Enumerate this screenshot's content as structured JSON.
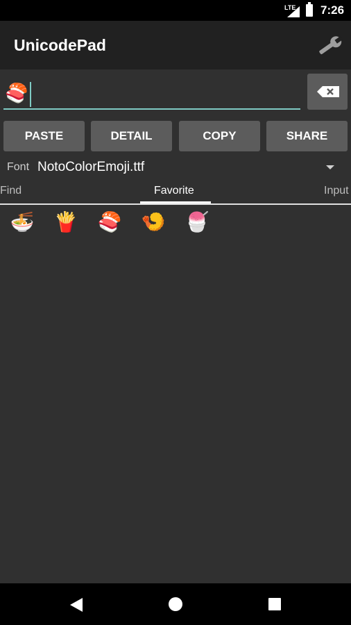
{
  "status_bar": {
    "network": "LTE",
    "time": "7:26"
  },
  "app_bar": {
    "title": "UnicodePad",
    "settings_icon": "wrench-icon"
  },
  "input": {
    "value": "🍣"
  },
  "buttons": {
    "paste": "PASTE",
    "detail": "DETAIL",
    "copy": "COPY",
    "share": "SHARE"
  },
  "font": {
    "label": "Font",
    "value": "NotoColorEmoji.ttf"
  },
  "tabs": [
    {
      "label": "Find",
      "active": false
    },
    {
      "label": "Favorite",
      "active": true
    },
    {
      "label": "Input",
      "active": false
    }
  ],
  "favorites": [
    "🍜",
    "🍟",
    "🍣",
    "🍤",
    "🍧"
  ],
  "nav_bar": {
    "back": "back-icon",
    "home": "home-icon",
    "recent": "recent-apps-icon"
  },
  "colors": {
    "accent": "#7fcbc4",
    "background": "#303030",
    "app_bar": "#212121",
    "button": "#5c5c5c"
  }
}
